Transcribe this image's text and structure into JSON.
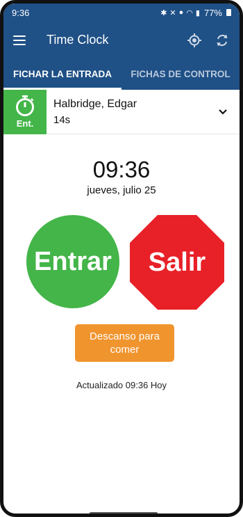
{
  "status_bar": {
    "time": "9:36",
    "battery": "77%"
  },
  "app_bar": {
    "title": "Time Clock",
    "icons": [
      "menu-icon",
      "locate-icon",
      "sync-icon"
    ]
  },
  "tabs": [
    {
      "label": "FICHAR LA ENTRADA",
      "active": true
    },
    {
      "label": "FICHAS DE CONTROL",
      "active": false
    }
  ],
  "employee": {
    "name": "Halbridge, Edgar",
    "elapsed": "14s",
    "status_label": "Ent."
  },
  "clock": {
    "time": "09:36",
    "date": "jueves, julio 25"
  },
  "actions": {
    "clock_in": "Entrar",
    "clock_out": "Salir",
    "meal_break": "Descanso para comer"
  },
  "footer": {
    "updated": "Actualizado 09:36 Hoy"
  },
  "colors": {
    "primary": "#1f5086",
    "green": "#44b549",
    "red": "#e82027",
    "orange": "#f0942e"
  }
}
